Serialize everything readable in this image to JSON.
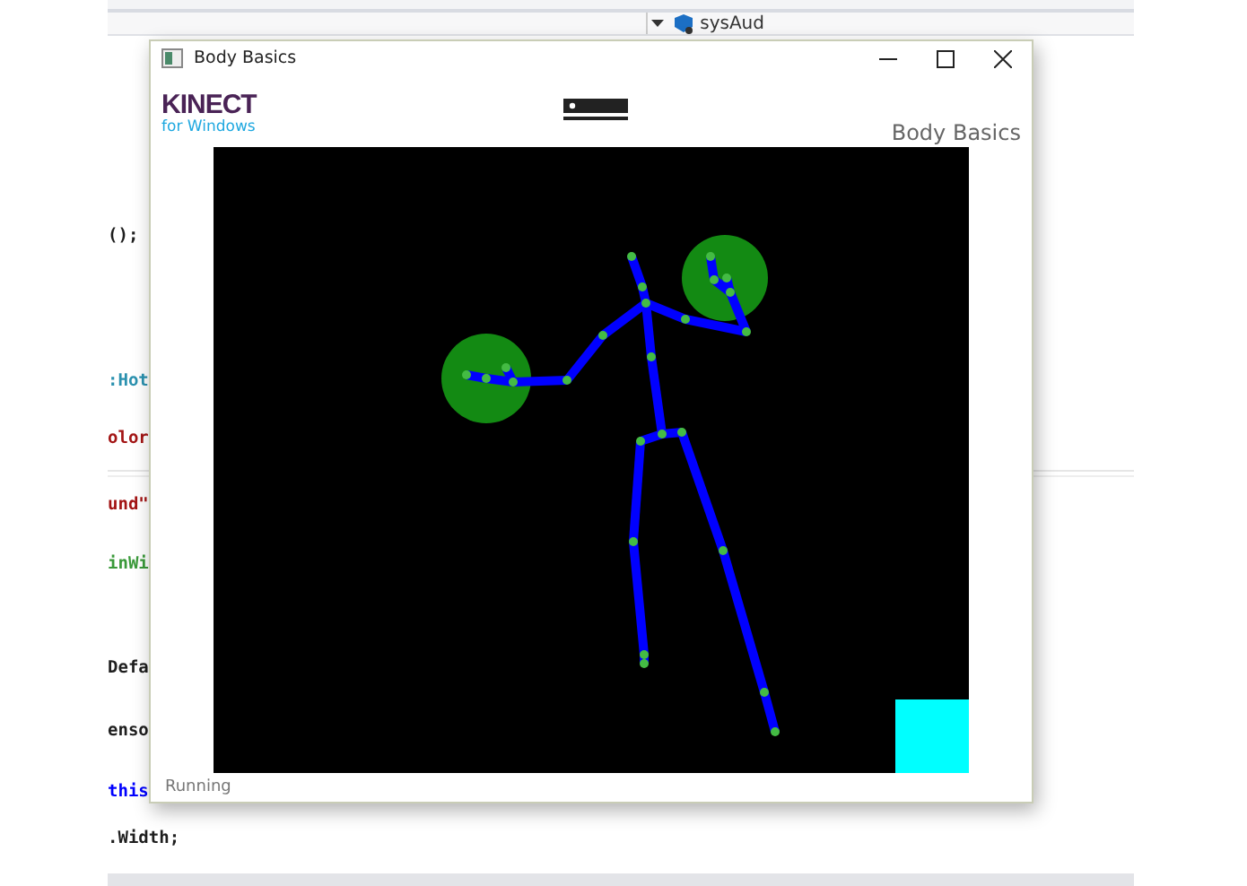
{
  "editor": {
    "toolbar": {
      "member_dropdown": "sysAud"
    },
    "code_lines": [
      {
        "text": "();",
        "kind": "plain"
      },
      {
        "text": ":Hot",
        "kind": "type"
      },
      {
        "text": "olor",
        "kind": "string"
      },
      {
        "text": "und\"",
        "kind": "string"
      },
      {
        "text": "inWi",
        "kind": "comment"
      },
      {
        "text": "Defa",
        "kind": "plain"
      },
      {
        "text": "enso",
        "kind": "plain"
      },
      {
        "text": "this",
        "kind": "keyword"
      },
      {
        "text": ".Width;",
        "kind": "plain"
      }
    ]
  },
  "window": {
    "title": "Body Basics",
    "logo": {
      "brand": "KINECT",
      "subtitle": "for Windows"
    },
    "heading": "Body Basics",
    "status_bar": "Running"
  }
}
